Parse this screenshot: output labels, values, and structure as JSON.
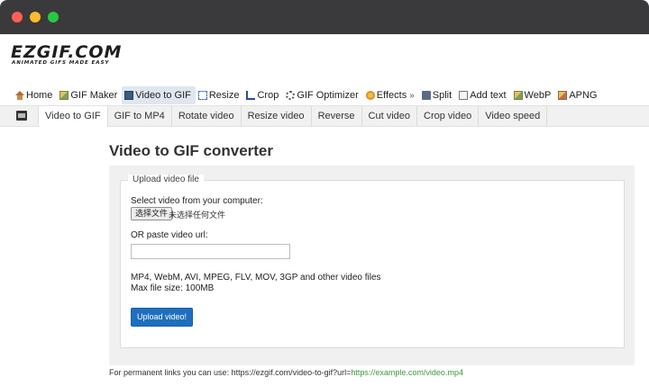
{
  "logo": {
    "text": "EZGIF.COM",
    "tagline": "ANIMATED GIFS MADE EASY"
  },
  "main_nav": [
    {
      "label": "Home",
      "icon": "home-icon",
      "active": false
    },
    {
      "label": "GIF Maker",
      "icon": "image-icon",
      "active": false
    },
    {
      "label": "Video to GIF",
      "icon": "film-icon",
      "active": true
    },
    {
      "label": "Resize",
      "icon": "resize-icon",
      "active": false
    },
    {
      "label": "Crop",
      "icon": "crop-icon",
      "active": false
    },
    {
      "label": "GIF Optimizer",
      "icon": "gear-icon",
      "active": false
    },
    {
      "label": "Effects",
      "icon": "effects-icon",
      "active": false,
      "suffix": "»"
    },
    {
      "label": "Split",
      "icon": "split-icon",
      "active": false
    },
    {
      "label": "Add text",
      "icon": "text-icon",
      "active": false
    },
    {
      "label": "WebP",
      "icon": "webp-icon",
      "active": false
    },
    {
      "label": "APNG",
      "icon": "apng-icon",
      "active": false
    }
  ],
  "sub_nav": [
    {
      "label": "Video to GIF",
      "active": true
    },
    {
      "label": "GIF to MP4",
      "active": false
    },
    {
      "label": "Rotate video",
      "active": false
    },
    {
      "label": "Resize video",
      "active": false
    },
    {
      "label": "Reverse",
      "active": false
    },
    {
      "label": "Cut video",
      "active": false
    },
    {
      "label": "Crop video",
      "active": false
    },
    {
      "label": "Video speed",
      "active": false
    }
  ],
  "main": {
    "title": "Video to GIF converter",
    "fieldset_legend": "Upload video file",
    "select_label": "Select video from your computer:",
    "file_button": "选择文件",
    "file_status": "未选择任何文件",
    "url_label": "OR paste video url:",
    "url_value": "",
    "formats_text": "MP4, WebM, AVI, MPEG, FLV, MOV, 3GP and other video files",
    "max_size_text": "Max file size: 100MB",
    "upload_button": "Upload video!",
    "permanent_prefix": "For permanent links you can use: https://ezgif.com/video-to-gif?url=",
    "permanent_link": "https://example.com/video.mp4"
  }
}
